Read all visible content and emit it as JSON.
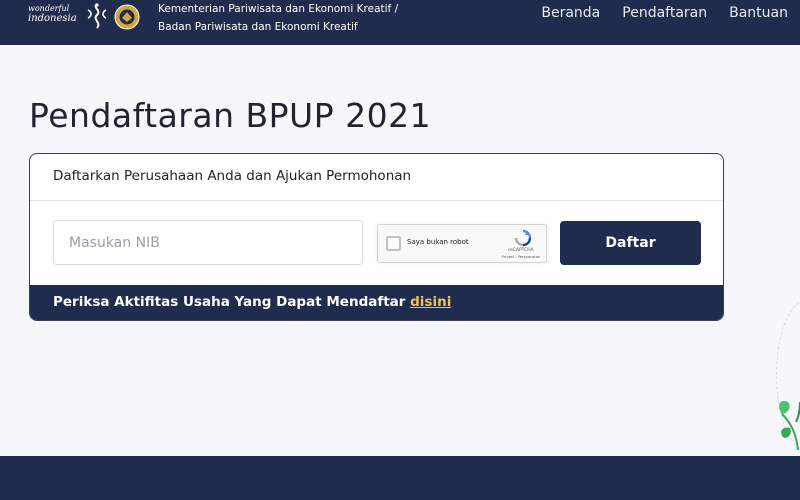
{
  "header": {
    "logo": {
      "line1": "wonderful",
      "line2": "indonesia"
    },
    "ministry_line1": "Kementerian Pariwisata dan Ekonomi Kreatif /",
    "ministry_line2": "Badan Pariwisata dan Ekonomi Kreatif",
    "nav": [
      {
        "label": "Beranda"
      },
      {
        "label": "Pendaftaran"
      },
      {
        "label": "Bantuan"
      }
    ]
  },
  "page": {
    "title": "Pendaftaran BPUP 2021"
  },
  "card": {
    "heading": "Daftarkan Perusahaan Anda dan Ajukan Permohonan",
    "nib_input": {
      "value": "",
      "placeholder": "Masukan NIB"
    },
    "recaptcha": {
      "label": "Saya bukan robot",
      "brand": "reCAPTCHA",
      "terms": "Privasi - Persyaratan"
    },
    "submit_label": "Daftar",
    "footer_text": "Periksa Aktifitas Usaha Yang Dapat Mendaftar",
    "footer_link": "disini"
  },
  "colors": {
    "primary": "#1f2c4d",
    "accent": "#f0c150",
    "background": "#f5f7fa"
  },
  "icons": [
    "wonderful-indonesia-logo-icon",
    "garuda-emblem-icon",
    "recaptcha-logo-icon",
    "plant-icon"
  ]
}
